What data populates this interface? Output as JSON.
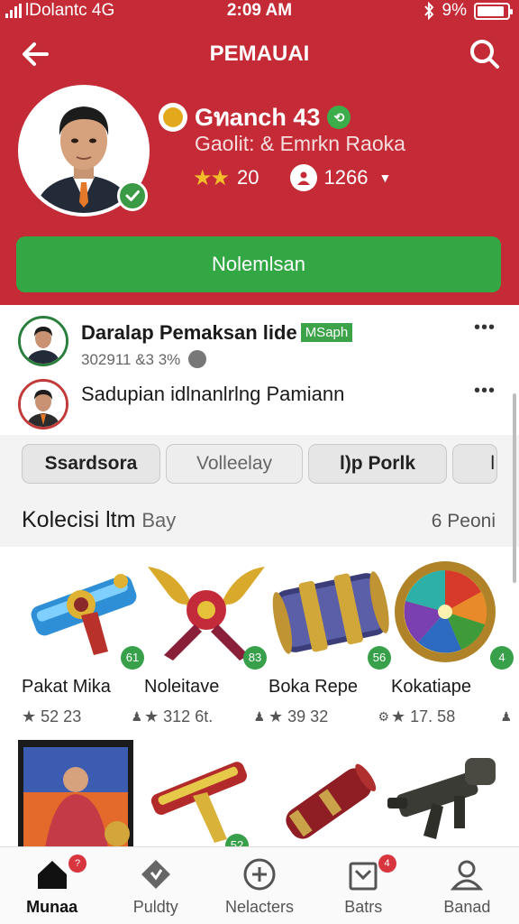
{
  "status_bar": {
    "carrier": "lDolantc 4G",
    "time": "2:09 AM",
    "battery": "9%",
    "battery_level": 0.9
  },
  "header": {
    "title": "PEMAUAI",
    "back_icon": "arrow-left-icon",
    "search_icon": "search-icon"
  },
  "profile": {
    "name": "Gทanch 43",
    "subtitle": "Gaolit: & Emrkn Raoka",
    "rating": "20",
    "followers": "1266",
    "primary_button": "Nolemlsan",
    "accent": "#c42b36",
    "cta_color": "#33a744"
  },
  "feed": [
    {
      "title": "Daralap Pemaksan lide",
      "badge": "MSaph",
      "subtitle": "302911 &3 3%"
    },
    {
      "title": "Sadupian idlnanlrlng Pamiann"
    }
  ],
  "filters": [
    "Ssardsora",
    "Volleelay",
    "l)p Porlk",
    "l"
  ],
  "collection": {
    "title": "Kolecisi ltm",
    "title_suffix": "Bay",
    "count": "6 Peoni"
  },
  "items": [
    {
      "name": "Pakat Mika",
      "rating": "52 23",
      "level": "61"
    },
    {
      "name": "Noleitave",
      "rating": "312 6t.",
      "level": "83"
    },
    {
      "name": "Boka Repe",
      "rating": "39 32",
      "level": "56"
    },
    {
      "name": "Kokatiape",
      "rating": "17. 58",
      "level": "4"
    }
  ],
  "items_row2": [
    {
      "level": ""
    },
    {
      "level": "52"
    }
  ],
  "bottom_nav": [
    {
      "label": "Munaa",
      "icon": "home-icon",
      "badge": "?"
    },
    {
      "label": "Puldty",
      "icon": "tag-icon"
    },
    {
      "label": "Nelacters",
      "icon": "plus-circle-icon"
    },
    {
      "label": "Batrs",
      "icon": "bag-icon",
      "badge": "4"
    },
    {
      "label": "Banad",
      "icon": "user-icon"
    }
  ]
}
